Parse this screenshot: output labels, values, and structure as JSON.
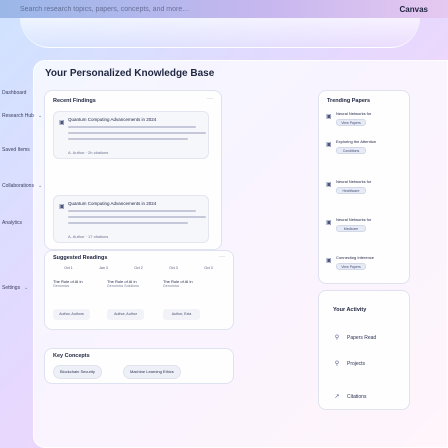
{
  "topbar": {
    "hint": "Search research topics, papers, concepts, and more…",
    "brand": "Canvas"
  },
  "page_title": "Your Personalized Knowledge Base",
  "sidebar": {
    "items": [
      {
        "label": "Dashboard",
        "chevron": ""
      },
      {
        "label": "Research Hub",
        "chevron": "⌄"
      },
      {
        "label": "Saved Items",
        "chevron": ""
      },
      {
        "label": "Collaborations",
        "chevron": "⌄"
      },
      {
        "label": "Analytics",
        "chevron": ""
      },
      {
        "label": "Settings",
        "chevron": "⌄"
      }
    ]
  },
  "recent_findings": {
    "title": "Recent Findings",
    "menu": "···",
    "items": [
      {
        "title": "Quantum Computing Advancements in 2024",
        "meta": "A. Author · 2h citations"
      },
      {
        "title": "Quantum Computing Advancements in 2024",
        "meta": "A. Author · 17 citations"
      }
    ]
  },
  "suggested": {
    "title": "Suggested Readings",
    "menu": "···",
    "dates": [
      "Oct 1",
      "Jan 3",
      "Oct 2",
      "Oct 3",
      "Oct 3"
    ],
    "cols": [
      {
        "title": "The Role of AI in",
        "sub": "Genomics"
      },
      {
        "title": "The Role of AI in",
        "sub": "Genomics Solutions"
      },
      {
        "title": "The Role of AI in",
        "sub": "Genomics"
      }
    ],
    "authors": [
      "Author, Authors",
      "Author, Author",
      "Author, Exta"
    ]
  },
  "key_concepts": {
    "title": "Key Concepts",
    "items": [
      "Blockchain Security",
      "Machine Learning Ethics"
    ]
  },
  "trending": {
    "title": "Trending Papers",
    "items": [
      {
        "title": "Neural Networks for",
        "btn": "View Papers"
      },
      {
        "title": "Exploring the Attention",
        "btn": "Conditions"
      },
      {
        "title": "Neural Networks for",
        "btn": "Healthcare"
      },
      {
        "title": "Neural Networks for",
        "btn": "Medicare"
      },
      {
        "title": "Connecting Inference",
        "btn": "View Papers"
      }
    ]
  },
  "activity": {
    "title": "Your Activity",
    "items": [
      {
        "icon": "⚲",
        "label": "Papers Read"
      },
      {
        "icon": "⚲",
        "label": "Projects"
      },
      {
        "icon": "↗",
        "label": "Citations"
      }
    ]
  }
}
